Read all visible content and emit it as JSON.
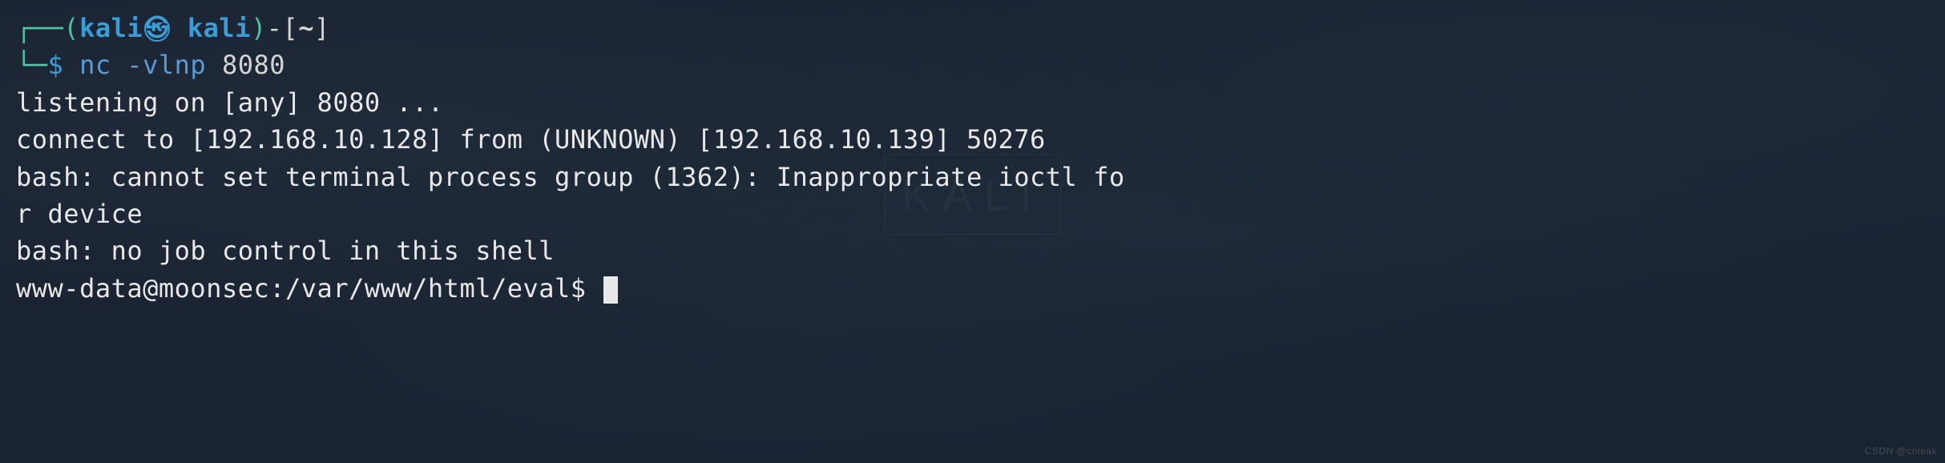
{
  "prompt": {
    "box_top": "┌──",
    "box_bottom": "└─",
    "paren_open": "(",
    "paren_close": ")",
    "user": "kali",
    "separator_icon": "㉿",
    "host": "kali",
    "connector": "-",
    "bracket_open": "[",
    "path": "~",
    "bracket_close": "]",
    "dollar": "$",
    "command": "nc -vlnp",
    "args": "8080"
  },
  "output": {
    "line1": "listening on [any] 8080 ...",
    "line2": "connect to [192.168.10.128] from (UNKNOWN) [192.168.10.139] 50276",
    "line3": "bash: cannot set terminal process group (1362): Inappropriate ioctl fo",
    "line4": "r device",
    "line5": "bash: no job control in this shell"
  },
  "shell_prompt": "www-data@moonsec:/var/www/html/eval$ ",
  "watermark": "CSDN @coleak",
  "bg_text": "KALI"
}
